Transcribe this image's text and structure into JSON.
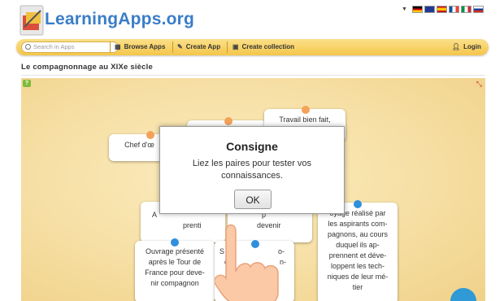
{
  "header": {
    "logo_text": "LearningApps.org",
    "flags": [
      "de-flag",
      "gb-flag",
      "es-flag",
      "fr-flag",
      "it-flag",
      "ru-flag"
    ]
  },
  "nav": {
    "search_placeholder": "Search in Apps",
    "browse": "Browse Apps",
    "create": "Create App",
    "collection": "Create collection",
    "login": "Login"
  },
  "page": {
    "title": "Le compagnonnage au XIXe siècle"
  },
  "cards": {
    "c1": "Chef d'œ",
    "c2": "Travail bien fait,",
    "c3a": "A",
    "c3b": "prenti",
    "c4a": "p",
    "c4b": "devenir",
    "c5a": "Ouvrage présenté",
    "c5b": "après le Tour de",
    "c5c": "France pour deve-",
    "c5d": "nir compagnon",
    "c6a": "S",
    "c6b": "o-",
    "c6c": "ci",
    "c6d": "n-",
    "c7a": "oyage réalisé par",
    "c7b": "les aspirants com-",
    "c7c": "pagnons, au cours",
    "c7d": "duquel ils ap-",
    "c7e": "prennent et déve-",
    "c7f": "loppent les tech-",
    "c7g": "niques de leur mé-",
    "c7h": "tier"
  },
  "dialog": {
    "title": "Consigne",
    "line1": "Liez les paires pour tester vos",
    "line2": "connaissances.",
    "ok": "OK"
  },
  "colors": {
    "nav_bar": "#f4c64a",
    "logo": "#3a7dc7",
    "dot_orange": "#f4a259",
    "dot_blue": "#2f8fdd"
  }
}
